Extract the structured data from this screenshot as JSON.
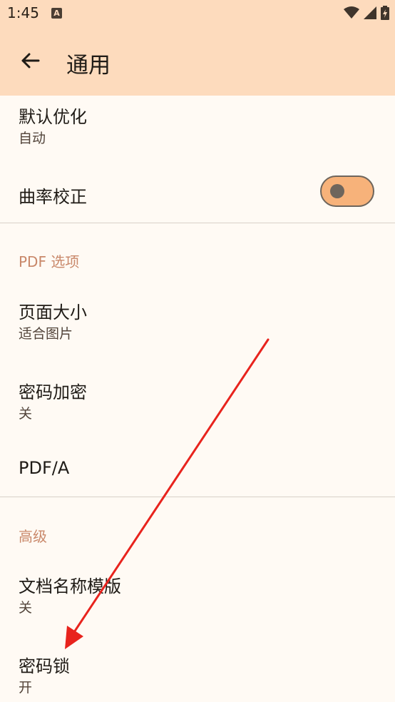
{
  "status_bar": {
    "time": "1:45",
    "notification_icon": "A",
    "icons": [
      "wifi-icon",
      "signal-icon",
      "battery-charging-icon"
    ]
  },
  "app_bar": {
    "back_icon": "arrow-back-icon",
    "title": "通用"
  },
  "settings": {
    "default_optimize": {
      "title": "默认优化",
      "summary": "自动"
    },
    "curvature_correction": {
      "title": "曲率校正",
      "toggle_state": "off"
    },
    "pdf_section": {
      "header": "PDF 选项"
    },
    "page_size": {
      "title": "页面大小",
      "summary": "适合图片"
    },
    "password_encrypt": {
      "title": "密码加密",
      "summary": "关"
    },
    "pdf_a": {
      "title": "PDF/A"
    },
    "advanced_section": {
      "header": "高级"
    },
    "doc_name_template": {
      "title": "文档名称模版",
      "summary": "关"
    },
    "password_lock": {
      "title": "密码锁",
      "summary": "开"
    }
  },
  "colors": {
    "app_bar_bg": "#fddbbd",
    "page_bg": "#fffaf4",
    "accent": "#c9886a",
    "toggle_track": "#f7b27a",
    "annotation_arrow": "#e8231d"
  }
}
